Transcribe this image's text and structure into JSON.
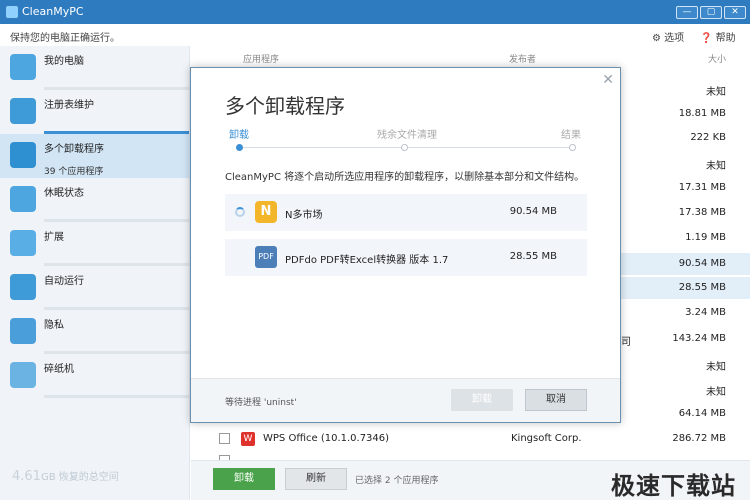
{
  "window": {
    "title": "CleanMyPC",
    "subtitle": "保持您的电脑正确运行。",
    "options_label": "选项",
    "help_label": "帮助",
    "minimize": "—",
    "maximize": "▢",
    "close": "✕"
  },
  "sidebar": {
    "items": [
      {
        "label": "我的电脑",
        "sub": ""
      },
      {
        "label": "注册表维护",
        "sub": ""
      },
      {
        "label": "多个卸载程序",
        "sub": "39 个应用程序"
      },
      {
        "label": "休眠状态",
        "sub": ""
      },
      {
        "label": "扩展",
        "sub": ""
      },
      {
        "label": "自动运行",
        "sub": ""
      },
      {
        "label": "隐私",
        "sub": ""
      },
      {
        "label": "碎纸机",
        "sub": ""
      }
    ],
    "storage_value": "4.61",
    "storage_text": "GB 恢复的总空间"
  },
  "list": {
    "headers": {
      "app": "应用程序",
      "publisher": "发布者",
      "size": "大小"
    },
    "sizes": [
      "未知",
      "18.81 MB",
      "222 KB",
      "未知",
      "17.31 MB",
      "17.38 MB",
      "1.19 MB",
      "90.54 MB",
      "28.55 MB",
      "3.24 MB",
      "143.24 MB",
      "未知",
      "未知",
      "64.14 MB"
    ],
    "partial_publisher": "司",
    "wps_row": {
      "name": "WPS Office (10.1.0.7346)",
      "publisher": "Kingsoft Corp.",
      "size": "286.72 MB",
      "icon": "W"
    }
  },
  "bottom": {
    "uninstall_label": "卸载",
    "refresh_label": "刷新",
    "selection_info": "已选择 2 个应用程序",
    "watermark": "极速下载站"
  },
  "dialog": {
    "title": "多个卸载程序",
    "steps": [
      "卸载",
      "残余文件清理",
      "结果"
    ],
    "description": "CleanMyPC 将逐个启动所选应用程序的卸载程序，以删除基本部分和文件结构。",
    "apps": [
      {
        "name": "N多市场",
        "size": "90.54 MB",
        "icon": "N"
      },
      {
        "name": "PDFdo PDF转Excel转换器 版本 1.7",
        "size": "28.55 MB",
        "icon": "PDF"
      }
    ],
    "status": "等待进程 'uninst'",
    "uninstall_button": "卸载",
    "cancel_button": "取消",
    "close_glyph": "✕"
  }
}
